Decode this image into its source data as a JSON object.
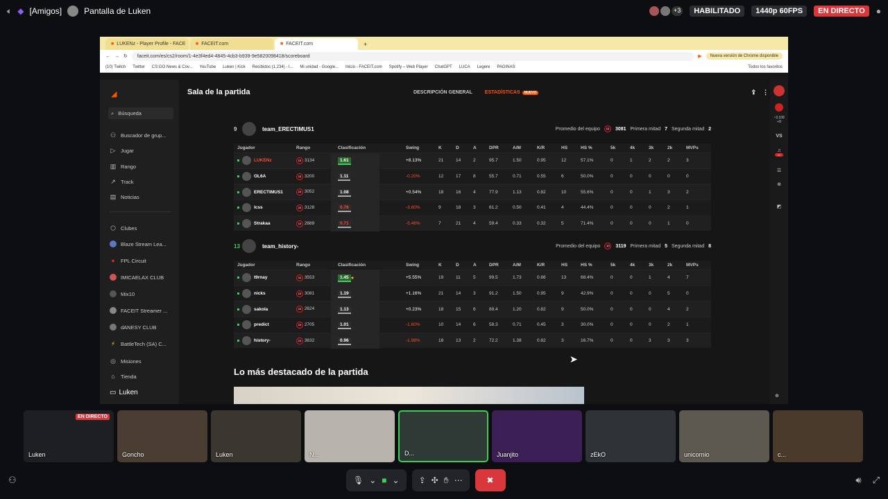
{
  "discord": {
    "channel": "[Amigos]",
    "screen_title": "Pantalla de Luken",
    "extra_count": "+3",
    "habilitado": "HABILITADO",
    "resolution": "1440p 60FPS",
    "live": "EN DIRECTO"
  },
  "chrome": {
    "tabs": [
      "LUKENz - Player Profile - FACE",
      "FACEIT.com",
      "FACEIT.com"
    ],
    "url": "faceit.com/es/cs2/room/1-4e3f4ed4-4845-4cb3-b939-9e5820098418/scoreboard",
    "update": "Nueva versión de Chrome disponible",
    "bookmarks": [
      "(10) Twitch",
      "Twitter",
      "CS:GO News & Cov...",
      "YouTube",
      "Luken | Kick",
      "Recibidos (1.234) - l...",
      "Mi unidad - Google...",
      "Inicio - FACEIT.com",
      "Spotify – Web Player",
      "ChatGPT",
      "LUCA",
      "Legere",
      "PAGINAS"
    ],
    "all_bookmarks": "Todos los favoritos"
  },
  "sidebar": {
    "search": "Búsqueda",
    "items": [
      "Buscador de grup...",
      "Jugar",
      "Rango",
      "Track",
      "Noticias"
    ],
    "clubs_title": "Clubes",
    "clubs": [
      "Blaze Stream Lea...",
      "FPL Circuit",
      "IMICAELAX CLUB",
      "Mix10",
      "FACEIT Streamer ...",
      "dANESY CLUB",
      "BattleTech (SA) C..."
    ],
    "bottom": [
      "Misiones",
      "Tienda"
    ]
  },
  "header": {
    "title": "Sala de la partida",
    "nav_overview": "DESCRIPCIÓN GENERAL",
    "nav_stats": "ESTADÍSTICAS",
    "nav_badge": "NUEVO"
  },
  "right_rail": {
    "elo": "~3.109",
    "elo_delta": "+9",
    "vs": "VS",
    "notif": "62"
  },
  "columns": [
    "Jugador",
    "Rango",
    "Clasificación",
    "Swing",
    "K",
    "D",
    "A",
    "DPR",
    "A/M",
    "K/R",
    "HS",
    "HS %",
    "5k",
    "4k",
    "3k",
    "2k",
    "MVPs"
  ],
  "teams": [
    {
      "score": "9",
      "name": "team_ERECTIMUS1",
      "avg_label": "Promedio del equipo",
      "avg": "3081",
      "first_label": "Primera mitad",
      "first": "7",
      "second_label": "Segunda mitad",
      "second": "2",
      "players": [
        {
          "name": "LUKENz",
          "elo": "3134",
          "rating": "1.61",
          "swing": "+8.13%",
          "k": "21",
          "d": "14",
          "a": "2",
          "dpr": "95.7",
          "am": "1.50",
          "kr": "0.95",
          "hs": "12",
          "hsp": "57.1%",
          "k5": "0",
          "k4": "1",
          "k3": "2",
          "k2": "2",
          "mvp": "3"
        },
        {
          "name": "OL6A",
          "elo": "3200",
          "rating": "1.11",
          "swing": "-0.20%",
          "k": "12",
          "d": "17",
          "a": "8",
          "dpr": "55.7",
          "am": "0.71",
          "kr": "0.55",
          "hs": "6",
          "hsp": "50.0%",
          "k5": "0",
          "k4": "0",
          "k3": "0",
          "k2": "0",
          "mvp": "0"
        },
        {
          "name": "ERECTIMUS1",
          "elo": "3052",
          "rating": "1.08",
          "swing": "+0.54%",
          "k": "18",
          "d": "16",
          "a": "4",
          "dpr": "77.9",
          "am": "1.13",
          "kr": "0.82",
          "hs": "10",
          "hsp": "55.6%",
          "k5": "0",
          "k4": "0",
          "k3": "1",
          "k2": "3",
          "mvp": "2"
        },
        {
          "name": "lcss",
          "elo": "3128",
          "rating": "0.78",
          "swing": "-3.60%",
          "k": "9",
          "d": "18",
          "a": "3",
          "dpr": "61.2",
          "am": "0.50",
          "kr": "0.41",
          "hs": "4",
          "hsp": "44.4%",
          "k5": "0",
          "k4": "0",
          "k3": "0",
          "k2": "2",
          "mvp": "1"
        },
        {
          "name": "Strakaa",
          "elo": "2889",
          "rating": "0.71",
          "swing": "-5.46%",
          "k": "7",
          "d": "21",
          "a": "4",
          "dpr": "59.4",
          "am": "0.33",
          "kr": "0.32",
          "hs": "5",
          "hsp": "71.4%",
          "k5": "0",
          "k4": "0",
          "k3": "0",
          "k2": "1",
          "mvp": "0"
        }
      ]
    },
    {
      "score": "13",
      "name": "team_history-",
      "avg_label": "Promedio del equipo",
      "avg": "3119",
      "first_label": "Primera mitad",
      "first": "5",
      "second_label": "Segunda mitad",
      "second": "8",
      "players": [
        {
          "name": "t9rnay",
          "elo": "3553",
          "rating": "1.45",
          "swing": "+5.55%",
          "k": "19",
          "d": "11",
          "a": "5",
          "dpr": "99.5",
          "am": "1.73",
          "kr": "0.86",
          "hs": "13",
          "hsp": "68.4%",
          "k5": "0",
          "k4": "0",
          "k3": "1",
          "k2": "4",
          "mvp": "7"
        },
        {
          "name": "nicks",
          "elo": "3081",
          "rating": "1.19",
          "swing": "+1.16%",
          "k": "21",
          "d": "14",
          "a": "3",
          "dpr": "91.2",
          "am": "1.50",
          "kr": "0.95",
          "hs": "9",
          "hsp": "42.9%",
          "k5": "0",
          "k4": "0",
          "k3": "0",
          "k2": "5",
          "mvp": "0"
        },
        {
          "name": "sakola",
          "elo": "2624",
          "rating": "1.13",
          "swing": "+0.23%",
          "k": "18",
          "d": "15",
          "a": "6",
          "dpr": "89.4",
          "am": "1.20",
          "kr": "0.82",
          "hs": "9",
          "hsp": "50.0%",
          "k5": "0",
          "k4": "0",
          "k3": "0",
          "k2": "4",
          "mvp": "2"
        },
        {
          "name": "predict",
          "elo": "2705",
          "rating": "1.01",
          "swing": "-1.60%",
          "k": "10",
          "d": "14",
          "a": "6",
          "dpr": "58.3",
          "am": "0.71",
          "kr": "0.45",
          "hs": "3",
          "hsp": "30.0%",
          "k5": "0",
          "k4": "0",
          "k3": "0",
          "k2": "2",
          "mvp": "1"
        },
        {
          "name": "history-",
          "elo": "3632",
          "rating": "0.96",
          "swing": "-1.98%",
          "k": "18",
          "d": "13",
          "a": "2",
          "dpr": "72.2",
          "am": "1.38",
          "kr": "0.82",
          "hs": "3",
          "hsp": "16.7%",
          "k5": "0",
          "k4": "0",
          "k3": "3",
          "k2": "3",
          "mvp": "3"
        }
      ]
    }
  ],
  "highlights_title": "Lo más destacado de la partida",
  "stream_label": "Luken",
  "participants": [
    {
      "name": "Luken",
      "live": "EN DIRECTO"
    },
    {
      "name": "Goncho"
    },
    {
      "name": "Luken"
    },
    {
      "name": "N..."
    },
    {
      "name": "D..."
    },
    {
      "name": "Juanjito"
    },
    {
      "name": "zEkO"
    },
    {
      "name": "unicornio"
    },
    {
      "name": "c..."
    }
  ],
  "level": "10"
}
